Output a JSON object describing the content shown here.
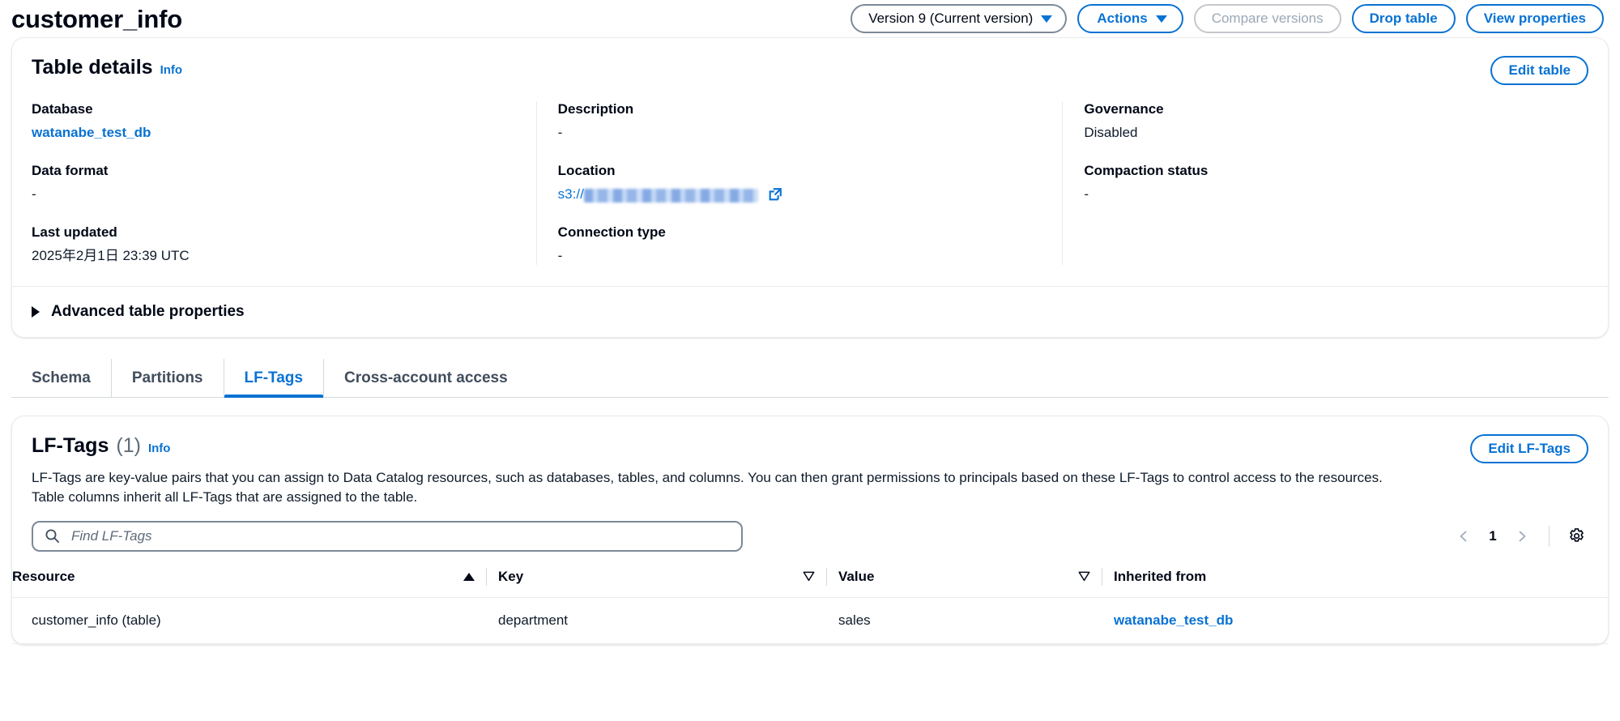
{
  "header": {
    "title": "customer_info",
    "version_selector": {
      "label": "Version 9 (Current version)",
      "icon": "chevron-down-icon"
    },
    "actions_button": {
      "label": "Actions",
      "icon": "chevron-down-icon"
    },
    "compare_versions_button": {
      "label": "Compare versions",
      "disabled": true
    },
    "drop_table_button": {
      "label": "Drop table"
    },
    "view_properties_button": {
      "label": "View properties"
    }
  },
  "table_details": {
    "title": "Table details",
    "info_label": "Info",
    "edit_button": "Edit table",
    "columns": [
      {
        "fields": [
          {
            "label": "Database",
            "value": "watanabe_test_db",
            "type": "link"
          },
          {
            "label": "Data format",
            "value": "-",
            "type": "text"
          },
          {
            "label": "Last updated",
            "value": "2025年2月1日 23:39 UTC",
            "type": "text"
          }
        ]
      },
      {
        "fields": [
          {
            "label": "Description",
            "value": "-",
            "type": "text"
          },
          {
            "label": "Location",
            "value": "s3://",
            "type": "redacted-link",
            "external_icon": "external-link-icon"
          },
          {
            "label": "Connection type",
            "value": "-",
            "type": "text"
          }
        ]
      },
      {
        "fields": [
          {
            "label": "Governance",
            "value": "Disabled",
            "type": "text"
          },
          {
            "label": "Compaction status",
            "value": "-",
            "type": "text"
          }
        ]
      }
    ],
    "advanced_properties": {
      "label": "Advanced table properties",
      "expanded": false,
      "icon": "triangle-right-icon"
    }
  },
  "tabs": [
    {
      "label": "Schema",
      "active": false
    },
    {
      "label": "Partitions",
      "active": false
    },
    {
      "label": "LF-Tags",
      "active": true
    },
    {
      "label": "Cross-account access",
      "active": false
    }
  ],
  "lf_tags_panel": {
    "title": "LF-Tags",
    "count": "(1)",
    "info_label": "Info",
    "edit_button": "Edit LF-Tags",
    "description_line1": "LF-Tags are key-value pairs that you can assign to Data Catalog resources, such as databases, tables, and columns. You can then grant permissions to principals based on these LF-Tags to control access to the resources.",
    "description_line2": "Table columns inherit all LF-Tags that are assigned to the table.",
    "search": {
      "placeholder": "Find LF-Tags",
      "value": "",
      "icon": "search-icon"
    },
    "pagination": {
      "prev_icon": "chevron-left-icon",
      "page": "1",
      "next_icon": "chevron-right-icon",
      "settings_icon": "gear-icon"
    },
    "table": {
      "headers": [
        {
          "label": "Resource",
          "sort": "asc"
        },
        {
          "label": "Key",
          "sort": "none"
        },
        {
          "label": "Value",
          "sort": "none"
        },
        {
          "label": "Inherited from",
          "sort": null
        }
      ],
      "rows": [
        {
          "resource": "customer_info (table)",
          "key": "department",
          "value": "sales",
          "inherited_from": "watanabe_test_db"
        }
      ]
    }
  },
  "colors": {
    "accent": "#0972d3",
    "text": "#000716",
    "muted": "#5f6b7a",
    "border": "#e9ebed"
  }
}
